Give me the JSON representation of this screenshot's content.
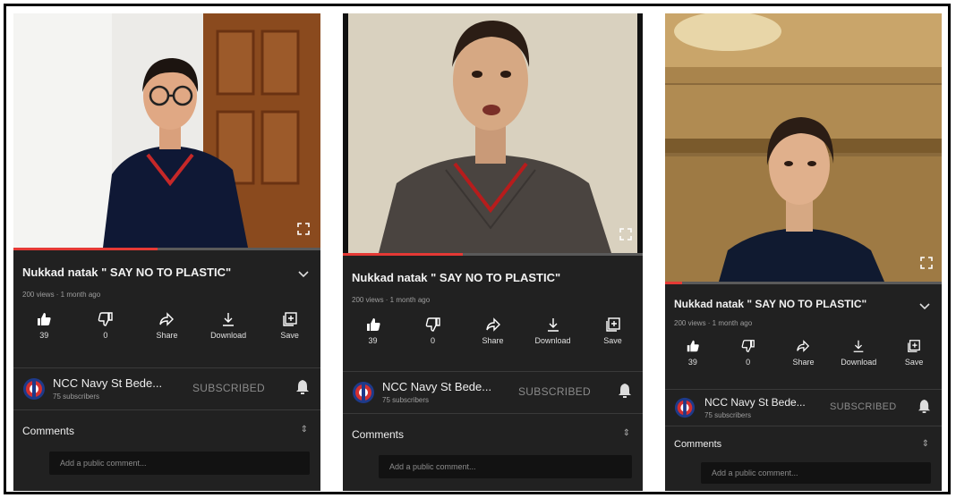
{
  "colors": {
    "panel_bg": "#212121",
    "accent_red": "#e53935",
    "text_muted": "#9e9e9e"
  },
  "icons": [
    "like-icon",
    "dislike-icon",
    "share-icon",
    "download-icon",
    "save-icon",
    "bell-icon",
    "chevron-down-icon",
    "fullscreen-icon",
    "expand-icon"
  ],
  "videos": [
    {
      "title": "Nukkad natak \" SAY NO TO PLASTIC\"",
      "meta": "200 views · 1 month ago",
      "likes": "39",
      "dislikes": "0",
      "share_label": "Share",
      "download_label": "Download",
      "save_label": "Save",
      "channel_name": "NCC Navy St Bede...",
      "subscribers": "75 subscribers",
      "subscribe_state": "SUBSCRIBED",
      "comments_label": "Comments",
      "comment_placeholder": "Add a public comment...",
      "progress": 0.47
    },
    {
      "title": "Nukkad natak \" SAY NO TO PLASTIC\"",
      "meta": "200 views · 1 month ago",
      "likes": "39",
      "dislikes": "0",
      "share_label": "Share",
      "download_label": "Download",
      "save_label": "Save",
      "channel_name": "NCC Navy St Bede...",
      "subscribers": "75 subscribers",
      "subscribe_state": "SUBSCRIBED",
      "comments_label": "Comments",
      "comment_placeholder": "Add a public comment...",
      "progress": 0.4
    },
    {
      "title": "Nukkad natak \" SAY NO TO PLASTIC\"",
      "meta": "200 views · 1 month ago",
      "likes": "39",
      "dislikes": "0",
      "share_label": "Share",
      "download_label": "Download",
      "save_label": "Save",
      "channel_name": "NCC Navy St Bede...",
      "subscribers": "75 subscribers",
      "subscribe_state": "SUBSCRIBED",
      "comments_label": "Comments",
      "comment_placeholder": "Add a public comment...",
      "progress": 0.06
    }
  ]
}
